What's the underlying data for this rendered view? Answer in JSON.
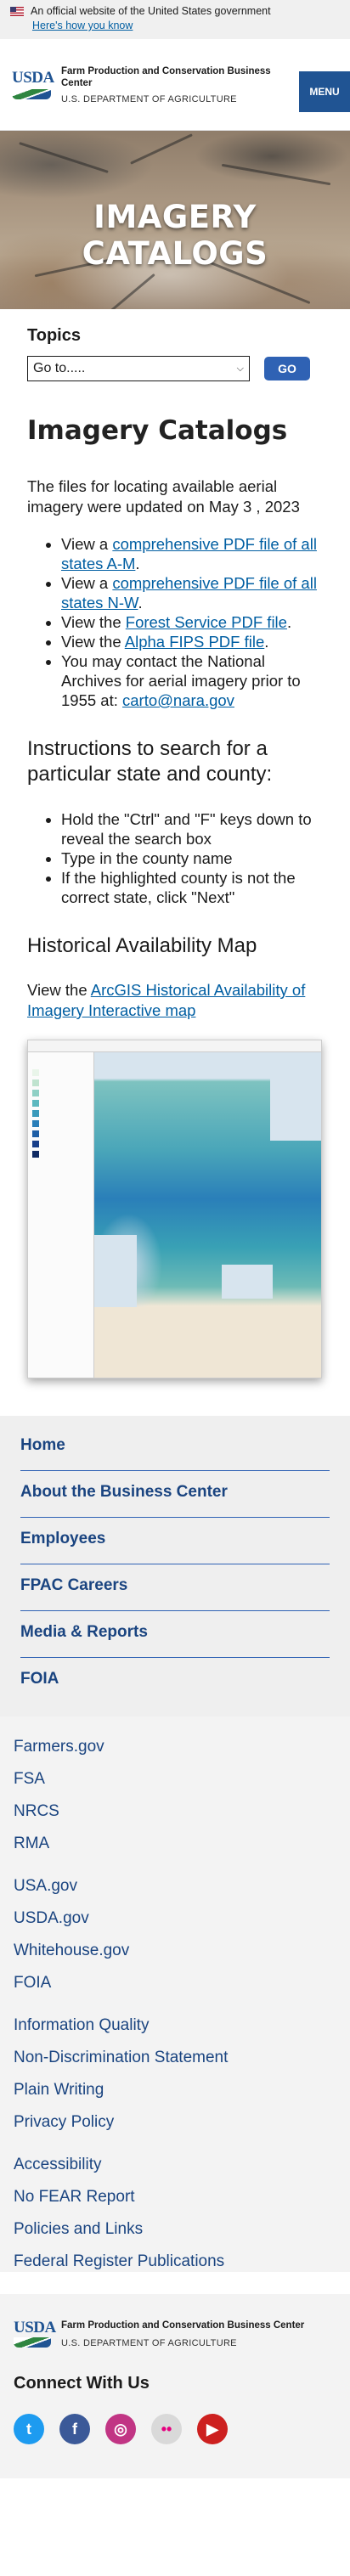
{
  "gov_banner": {
    "text": "An official website of the United States government",
    "link": "Here's how you know"
  },
  "header": {
    "logo_text": "USDA",
    "agency": "Farm Production and Conservation Business Center",
    "department": "U.S. DEPARTMENT OF AGRICULTURE",
    "menu_label": "MENU"
  },
  "hero": {
    "title": "IMAGERY CATALOGS"
  },
  "topics": {
    "label": "Topics",
    "select_value": "Go to.....",
    "go_label": "GO"
  },
  "content": {
    "title": "Imagery Catalogs",
    "intro": "The files for locating available aerial imagery were updated on May 3 , 2023",
    "items": [
      {
        "pre": "View a ",
        "link": "comprehensive PDF file of all states A-M",
        "post": "."
      },
      {
        "pre": "View a ",
        "link": "comprehensive PDF file of all states N-W",
        "post": "."
      },
      {
        "pre": "View the ",
        "link": "Forest Service PDF file",
        "post": "."
      },
      {
        "pre": "View the ",
        "link": "Alpha FIPS PDF file",
        "post": "."
      },
      {
        "pre": "You may contact the National Archives for aerial imagery prior to 1955 at: ",
        "link": "carto@nara.gov ",
        "post": ""
      }
    ],
    "instructions_heading": "Instructions to search for a particular state and county:",
    "steps": [
      "Hold the \"Ctrl\" and \"F\" keys down to reveal the search box",
      "Type in the county name",
      "If the highlighted county is not the correct state, click \"Next\""
    ],
    "history_heading": "Historical Availability Map",
    "history_pre": "View the ",
    "history_link": "ArcGIS Historical Availability of Imagery Interactive map"
  },
  "footer_nav": [
    "Home",
    "About the Business Center",
    "Employees",
    "FPAC Careers",
    "Media & Reports",
    "FOIA"
  ],
  "footer_links": {
    "agencies": [
      "Farmers.gov",
      "FSA",
      "NRCS",
      "RMA"
    ],
    "gov": [
      "USA.gov",
      "USDA.gov",
      "Whitehouse.gov",
      "FOIA"
    ],
    "policy": [
      "Information Quality",
      "Non-Discrimination Statement",
      "Plain Writing",
      "Privacy Policy"
    ],
    "other": [
      "Accessibility",
      "No FEAR Report",
      "Policies and Links",
      "Federal Register Publications"
    ]
  },
  "connect": {
    "heading": "Connect With Us",
    "icons": [
      {
        "name": "twitter-icon",
        "glyph": "t",
        "color": "#1d9bf0"
      },
      {
        "name": "facebook-icon",
        "glyph": "f",
        "color": "#3b5998"
      },
      {
        "name": "instagram-icon",
        "glyph": "◎",
        "color": "#c13584"
      },
      {
        "name": "flickr-icon",
        "glyph": "••",
        "color": "#d9d9d9"
      },
      {
        "name": "youtube-icon",
        "glyph": "▶",
        "color": "#cd201f"
      }
    ]
  },
  "colors": {
    "primary": "#205493",
    "link": "#005ea2",
    "button": "#2f62b4"
  }
}
